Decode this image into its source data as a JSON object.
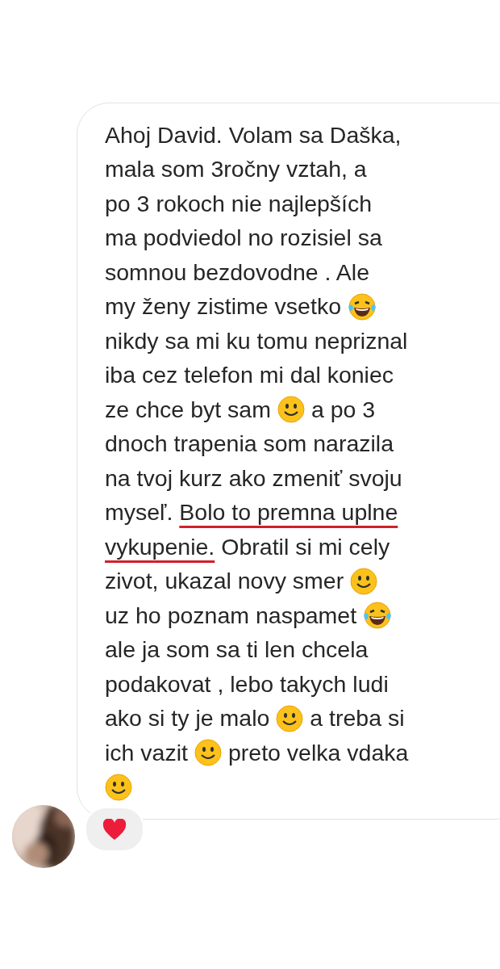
{
  "message": {
    "lines": [
      [
        {
          "kind": "text",
          "text": "Ahoj David. Volam sa Daška,",
          "underlined": false
        }
      ],
      [
        {
          "kind": "text",
          "text": "mala som 3ročny vztah, a",
          "underlined": false
        }
      ],
      [
        {
          "kind": "text",
          "text": "po 3 rokoch nie najlepších",
          "underlined": false
        }
      ],
      [
        {
          "kind": "text",
          "text": "ma podviedol no rozisiel sa",
          "underlined": false
        }
      ],
      [
        {
          "kind": "text",
          "text": "somnou bezdovodne . Ale",
          "underlined": false
        }
      ],
      [
        {
          "kind": "text",
          "text": "my ženy zistime vsetko",
          "underlined": false
        },
        {
          "kind": "laugh"
        }
      ],
      [
        {
          "kind": "text",
          "text": "nikdy sa mi ku tomu nepriznal",
          "underlined": false
        }
      ],
      [
        {
          "kind": "text",
          "text": "iba cez telefon mi dal koniec",
          "underlined": false
        }
      ],
      [
        {
          "kind": "text",
          "text": "ze chce byt sam",
          "underlined": false
        },
        {
          "kind": "smile"
        },
        {
          "kind": "text",
          "text": "a po 3",
          "underlined": false
        }
      ],
      [
        {
          "kind": "text",
          "text": "dnoch trapenia som narazila",
          "underlined": false
        }
      ],
      [
        {
          "kind": "text",
          "text": "na tvoj kurz ako zmeniť svoju",
          "underlined": false
        }
      ],
      [
        {
          "kind": "text",
          "text": "myseľ.",
          "underlined": false
        },
        {
          "kind": "text",
          "text": "Bolo to premna uplne",
          "underlined": true
        }
      ],
      [
        {
          "kind": "text",
          "text": "vykupenie.",
          "underlined": true
        },
        {
          "kind": "text",
          "text": "Obratil si mi cely",
          "underlined": false
        }
      ],
      [
        {
          "kind": "text",
          "text": "zivot, ukazal novy smer",
          "underlined": false
        },
        {
          "kind": "smile"
        }
      ],
      [
        {
          "kind": "text",
          "text": "uz ho poznam naspamet",
          "underlined": false
        },
        {
          "kind": "laugh"
        }
      ],
      [
        {
          "kind": "text",
          "text": "ale ja som sa ti len chcela",
          "underlined": false
        }
      ],
      [
        {
          "kind": "text",
          "text": "podakovat , lebo takych ludi",
          "underlined": false
        }
      ],
      [
        {
          "kind": "text",
          "text": "ako si ty je malo",
          "underlined": false
        },
        {
          "kind": "smile"
        },
        {
          "kind": "text",
          "text": "a treba si",
          "underlined": false
        }
      ],
      [
        {
          "kind": "text",
          "text": "ich vazit",
          "underlined": false
        },
        {
          "kind": "smile"
        },
        {
          "kind": "text",
          "text": "preto velka vdaka",
          "underlined": false
        }
      ],
      [
        {
          "kind": "smile"
        }
      ]
    ]
  },
  "reaction": {
    "liked": true
  }
}
